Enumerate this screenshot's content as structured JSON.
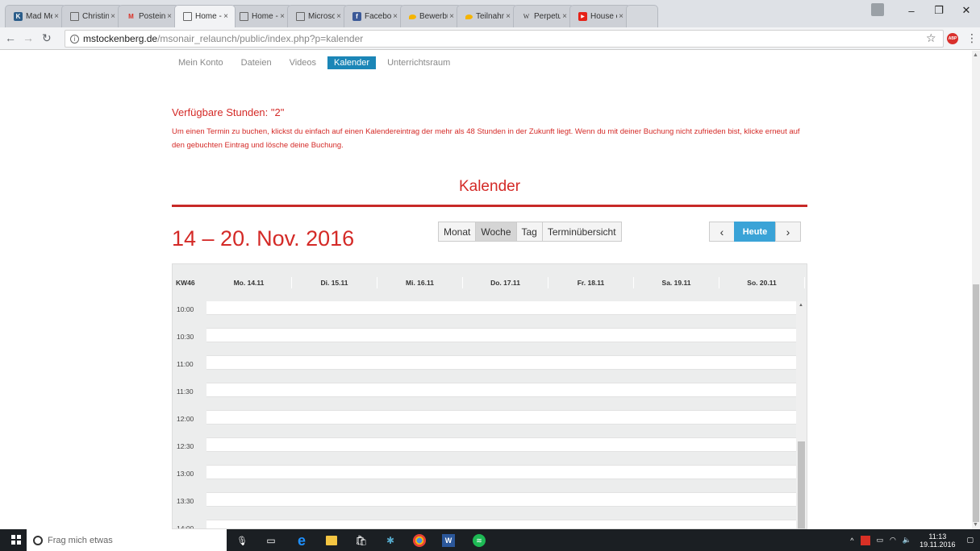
{
  "browser": {
    "tabs": [
      {
        "title": "Mad Men",
        "fav_color": "#2b5d8a",
        "fav": "K"
      },
      {
        "title": "Christin M",
        "fav_color": "",
        "fav": "doc"
      },
      {
        "title": "Posteinga",
        "fav_color": "#d93025",
        "fav": "M"
      },
      {
        "title": "Home - M",
        "fav_color": "",
        "fav": "doc",
        "active": true
      },
      {
        "title": "Home - M",
        "fav_color": "",
        "fav": "doc"
      },
      {
        "title": "Microsoft",
        "fav_color": "",
        "fav": "doc"
      },
      {
        "title": "Facebook",
        "fav_color": "#3b5998",
        "fav": "f"
      },
      {
        "title": "Bewerbun",
        "fav_color": "#f5b400",
        "fav": "bird"
      },
      {
        "title": "Teilnahme",
        "fav_color": "#f5b400",
        "fav": "bird"
      },
      {
        "title": "Perpetuum",
        "fav_color": "",
        "fav": "W"
      },
      {
        "title": "House of",
        "fav_color": "#e62117",
        "fav": "yt"
      }
    ],
    "url_domain": "mstockenberg.de",
    "url_path": "/msonair_relaunch/public/index.php?p=kalender"
  },
  "subnav": {
    "items": [
      "Mein Konto",
      "Dateien",
      "Videos",
      "Kalender",
      "Unterrichtsraum"
    ],
    "active_index": 3
  },
  "info": {
    "available_hours": "Verfügbare Stunden: \"2\"",
    "instructions": "Um einen Termin zu buchen, klickst du einfach auf einen Kalendereintrag der mehr als 48 Stunden in der Zukunft liegt. Wenn du mit deiner Buchung nicht zufrieden bist, klicke erneut auf den gebuchten Eintrag und lösche deine Buchung."
  },
  "calendar": {
    "title": "Kalender",
    "range": "14 – 20. Nov. 2016",
    "views": [
      "Monat",
      "Woche",
      "Tag",
      "Terminübersicht"
    ],
    "active_view": 1,
    "nav_prev": "‹",
    "nav_today": "Heute",
    "nav_next": "›",
    "week_label": "KW46",
    "days": [
      "Mo. 14.11",
      "Di. 15.11",
      "Mi. 16.11",
      "Do. 17.11",
      "Fr. 18.11",
      "Sa. 19.11",
      "So. 20.11"
    ],
    "times": [
      "10:00",
      "10:30",
      "11:00",
      "11:30",
      "12:00",
      "12:30",
      "13:00",
      "13:30",
      "14:00"
    ],
    "accent_color": "#d42a27"
  },
  "taskbar": {
    "search_placeholder": "Frag mich etwas",
    "time": "11:13",
    "date": "19.11.2016"
  }
}
